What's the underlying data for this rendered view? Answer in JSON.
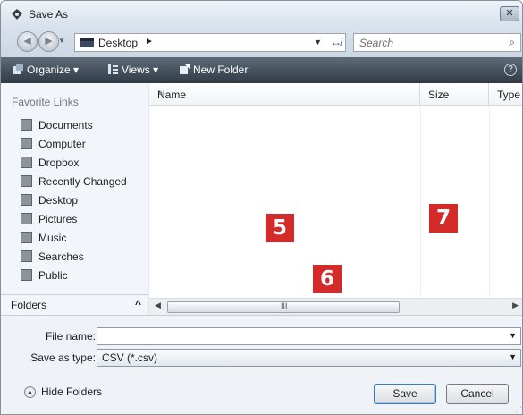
{
  "window": {
    "title": "Save As",
    "close_glyph": "✕"
  },
  "nav": {
    "back_glyph": "◀",
    "forward_glyph": "▶",
    "recent_glyph": "▼",
    "address": {
      "location": "Desktop",
      "chevron": "►",
      "dropdown_glyph": "▼",
      "refresh_glyph": "↮"
    },
    "search": {
      "placeholder": "Search",
      "icon_glyph": "⌕"
    }
  },
  "toolbar": {
    "organize": "Organize ▾",
    "views": "Views ▾",
    "new_folder": "New Folder",
    "help_glyph": "?"
  },
  "sidebar": {
    "section_title": "Favorite Links",
    "items": [
      {
        "label": "Documents",
        "icon": "documents-icon"
      },
      {
        "label": "Computer",
        "icon": "computer-icon"
      },
      {
        "label": "Dropbox",
        "icon": "dropbox-icon"
      },
      {
        "label": "Recently Changed",
        "icon": "recently-changed-icon"
      },
      {
        "label": "Desktop",
        "icon": "desktop-icon"
      },
      {
        "label": "Pictures",
        "icon": "pictures-icon"
      },
      {
        "label": "Music",
        "icon": "music-icon"
      },
      {
        "label": "Searches",
        "icon": "searches-icon"
      },
      {
        "label": "Public",
        "icon": "public-icon"
      }
    ],
    "folders_label": "Folders",
    "folders_caret": "^"
  },
  "file_list": {
    "columns": [
      "Name",
      "Size",
      "Type"
    ],
    "sort_glyph": "▲",
    "markers": [
      "5",
      "6",
      "7"
    ],
    "scroll_left": "◀",
    "scroll_right": "▶",
    "scroll_grip": "III"
  },
  "form": {
    "file_name_label": "File name:",
    "file_name_value": "",
    "save_type_label": "Save as type:",
    "save_type_value": "CSV (*.csv)",
    "dropdown_glyph": "▼"
  },
  "footer": {
    "hide_folders": "Hide Folders",
    "hide_glyph": "▲",
    "save": "Save",
    "cancel": "Cancel",
    "grip": "⋰"
  },
  "colors": {
    "marker_red": "#d32a2a",
    "toolbar_dark": "#2f3a45",
    "accent_blue": "#3d7bbf"
  }
}
